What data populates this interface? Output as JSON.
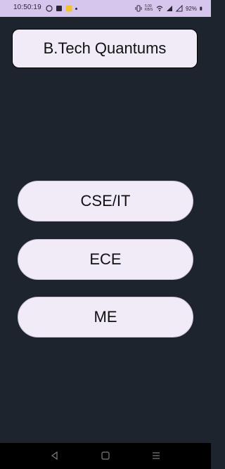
{
  "status_bar": {
    "time": "10:50:19",
    "battery": "92%",
    "data_speed": "5.00 KB/S",
    "icons": [
      "whatsapp-icon",
      "gallery-icon",
      "notification-app-icon",
      "dot-icon",
      "vibrate-icon",
      "network-speed-icon",
      "wifi-icon",
      "signal-icon",
      "signal-icon-2",
      "battery-icon"
    ]
  },
  "header": {
    "title": "B.Tech Quantums"
  },
  "branches": [
    {
      "label": "CSE/IT"
    },
    {
      "label": "ECE"
    },
    {
      "label": "ME"
    }
  ],
  "nav_bar": {
    "icons": [
      "back-icon",
      "home-icon",
      "recents-icon"
    ]
  },
  "colors": {
    "background": "#1d242e",
    "status_bar": "#d6c6ee",
    "button_fill": "#f0ebf7",
    "nav_bar": "#000000"
  }
}
